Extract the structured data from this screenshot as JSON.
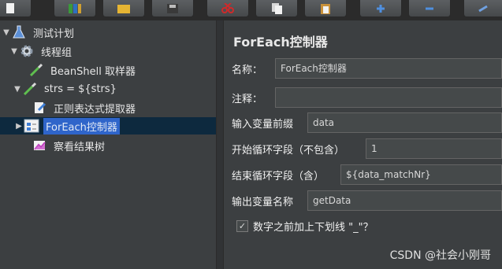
{
  "toolbar": {
    "buttons": [
      {
        "icon": "new-doc-icon"
      },
      {
        "icon": "templates-icon"
      },
      {
        "icon": "open-folder-icon"
      },
      {
        "icon": "save-icon"
      },
      {
        "icon": "cut-icon"
      },
      {
        "icon": "copy-icon"
      },
      {
        "icon": "paste-icon"
      },
      {
        "icon": "expand-icon"
      },
      {
        "icon": "collapse-icon"
      },
      {
        "icon": "toggle-icon"
      }
    ]
  },
  "tree": {
    "nodes": [
      {
        "label": "测试计划",
        "icon": "flask-icon",
        "arrow": "▼"
      },
      {
        "label": "线程组",
        "icon": "gear-icon",
        "arrow": "▼"
      },
      {
        "label": "BeanShell 取样器",
        "icon": "pipette-icon",
        "arrow": ""
      },
      {
        "label": "strs = ${strs}",
        "icon": "pipette-icon",
        "arrow": "▼"
      },
      {
        "label": "正则表达式提取器",
        "icon": "extractor-icon",
        "arrow": ""
      },
      {
        "label": "ForEach控制器",
        "icon": "foreach-icon",
        "arrow": "▶"
      },
      {
        "label": "察看结果树",
        "icon": "chart-icon",
        "arrow": ""
      }
    ]
  },
  "panel": {
    "title": "ForEach控制器",
    "name_label": "名称：",
    "name_value": "ForEach控制器",
    "comment_label": "注释：",
    "comment_value": "",
    "input_prefix_label": "输入变量前缀",
    "input_prefix_value": "data",
    "start_label": "开始循环字段（不包含）",
    "start_value": "1",
    "end_label": "结束循环字段（含）",
    "end_value": "${data_matchNr}",
    "output_label": "输出变量名称",
    "output_value": "getData",
    "checkbox_label": "数字之前加上下划线 \"_\"？",
    "checkbox_checked": "✓"
  },
  "watermark": "CSDN @社会小刚哥"
}
